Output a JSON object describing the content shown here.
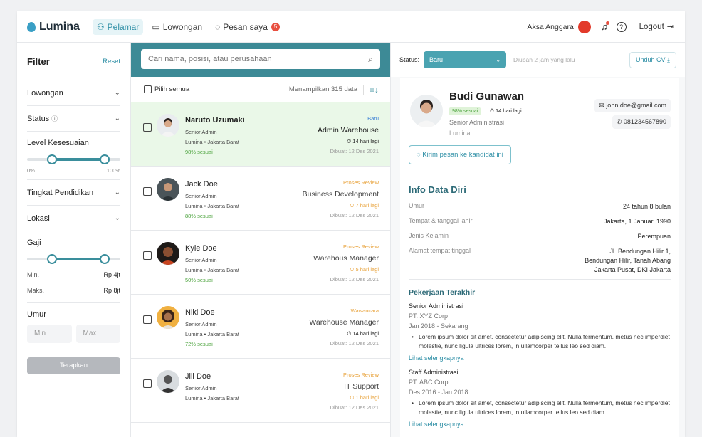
{
  "header": {
    "brand": "Lumina",
    "nav": [
      {
        "label": "Pelamar",
        "icon": "user-icon"
      },
      {
        "label": "Lowongan",
        "icon": "briefcase-icon"
      },
      {
        "label": "Pesan saya",
        "icon": "chat-icon",
        "badge": "5"
      }
    ],
    "user_name": "Aksa Anggara",
    "logout_label": "Logout"
  },
  "filter": {
    "title": "Filter",
    "reset": "Reset",
    "lowongan": "Lowongan",
    "status": "Status",
    "level_title": "Level Kesesuaian",
    "level_min": "0%",
    "level_max": "100%",
    "pendidikan": "Tingkat Pendidikan",
    "lokasi": "Lokasi",
    "gaji_title": "Gaji",
    "min_label": "Min.",
    "min_value": "Rp 4jt",
    "max_label": "Maks.",
    "max_value": "Rp 8jt",
    "umur_title": "Umur",
    "umur_min": "Min",
    "umur_max": "Max",
    "apply": "Terapkan"
  },
  "list": {
    "search_placeholder": "Cari nama, posisi, atau perusahaan",
    "select_all": "Pilih semua",
    "count": "Menampilkan 315 data",
    "candidates": [
      {
        "name": "Naruto Uzumaki",
        "position": "Senior Admin",
        "location": "Lumina • Jakarta Barat",
        "fit": "98% sesuai",
        "status": "Baru",
        "job": "Admin Warehouse",
        "deadline": "14 hari lagi",
        "created": "Dibuat: 12 Des 2021"
      },
      {
        "name": "Jack Doe",
        "position": "Senior Admin",
        "location": "Lumina • Jakarta Barat",
        "fit": "88% sesuai",
        "status": "Proses Review",
        "job": "Business Development",
        "deadline": "7 hari lagi",
        "created": "Dibuat: 12 Des 2021"
      },
      {
        "name": "Kyle Doe",
        "position": "Senior Admin",
        "location": "Lumina • Jakarta Barat",
        "fit": "50% sesuai",
        "status": "Proses Review",
        "job": "Warehous Manager",
        "deadline": "5 hari lagi",
        "created": "Dibuat: 12 Des 2021"
      },
      {
        "name": "Niki Doe",
        "position": "Senior Admin",
        "location": "Lumina • Jakarta Barat",
        "fit": "72% sesuai",
        "status": "Wawancara",
        "job": "Warehouse Manager",
        "deadline": "14 hari lagi",
        "created": "Dibuat: 12 Des 2021"
      },
      {
        "name": "Jill Doe",
        "position": "Senior Admin",
        "location": "Lumina • Jakarta Barat",
        "fit": "",
        "status": "Proses Review",
        "job": "IT Support",
        "deadline": "1 hari lagi",
        "created": "Dibuat: 12 Des 2021"
      }
    ]
  },
  "detail": {
    "status_label": "Status:",
    "status_value": "Baru",
    "changed": "Diubah 2 jam yang lalu",
    "download": "Unduh CV",
    "name": "Budi Gunawan",
    "fit": "98% sesuai",
    "deadline": "14 hari lagi",
    "position": "Senior Administrasi",
    "company": "Lumina",
    "email": "john.doe@gmail.com",
    "phone": "081234567890",
    "message_btn": "Kirim pesan ke kandidat ini",
    "info_title": "Info Data Diri",
    "info": [
      {
        "label": "Umur",
        "value": "24 tahun 8 bulan"
      },
      {
        "label": "Tempat & tanggal lahir",
        "value": "Jakarta, 1 Januari 1990"
      },
      {
        "label": "Jenis Kelamin",
        "value": "Perempuan"
      },
      {
        "label": "Alamat tempat tinggal",
        "value": "Jl. Bendungan Hilir 1, Bendungan Hilir, Tanah Abang Jakarta Pusat, DKI Jakarta"
      }
    ],
    "work_title": "Pekerjaan Terakhir",
    "jobs": [
      {
        "title": "Senior Administrasi",
        "company": "PT. XYZ Corp",
        "period": "Jan 2018 - Sekarang",
        "desc": "Lorem ipsum dolor sit amet, consectetur adipiscing elit. Nulla fermentum, metus nec imperdiet molestie, nunc ligula ultrices lorem, in ullamcorper tellus leo sed diam.",
        "more": "Lihat selengkapnya"
      },
      {
        "title": "Staff Administrasi",
        "company": "PT. ABC Corp",
        "period": "Des 2016 - Jan 2018",
        "desc": "Lorem ipsum dolor sit amet, consectetur adipiscing elit. Nulla fermentum, metus nec imperdiet molestie, nunc ligula ultrices lorem, in ullamcorper tellus leo sed diam.",
        "more": "Lihat selengkapnya"
      }
    ]
  },
  "colors": {
    "accent": "#3d8a96",
    "status_new": "#3a7fd5",
    "status_review": "#e8a23a",
    "fit_green": "#4aa23b",
    "selected_bg": "#eaf8e8"
  }
}
